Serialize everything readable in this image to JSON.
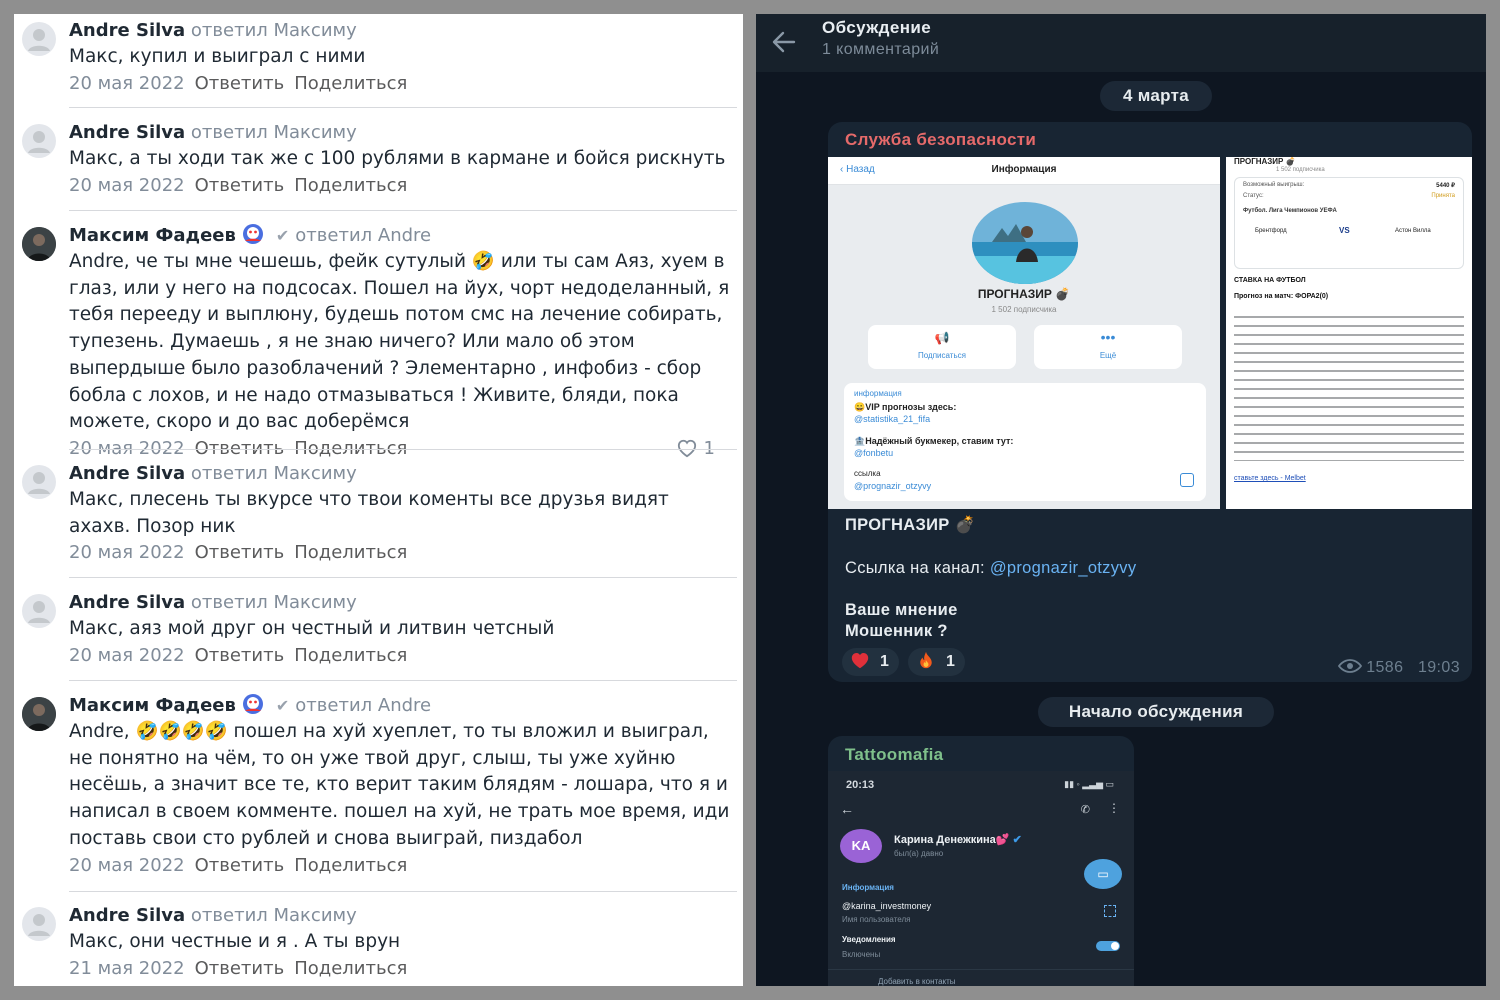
{
  "vk": {
    "comments": [
      {
        "author": "Andre Silva",
        "reply": "ответил Максиму",
        "text": "Макс, купил и выиграл с ними",
        "date": "20 мая 2022",
        "reply_action": "Ответить",
        "share_action": "Поделиться"
      },
      {
        "author": "Andre Silva",
        "reply": "ответил Максиму",
        "text": "Макс, а ты ходи так же с 100 рублями в кармане и бойся рискнуть",
        "date": "20 мая 2022",
        "reply_action": "Ответить",
        "share_action": "Поделиться"
      },
      {
        "author": "Максим Фадеев",
        "reply": "ответил Andre",
        "text": "Andre, че ты мне чешешь, фейк сутулый 🤣 или ты сам Аяз, хуем в глаз, или у него на подсосах. Пошел на йух, чорт недоделанный, я тебя перееду и выплюну, будешь потом смс на лечение собирать, тупезень. Думаешь , я не знаю ничего? Или мало об этом выпердыше было разоблачений ? Элементарно , инфобиз - сбор бобла с лохов, и не надо отмазываться ! Живите, бляди, пока можете, скоро и до вас доберёмся",
        "date": "20 мая 2022",
        "reply_action": "Ответить",
        "share_action": "Поделиться",
        "likes": "1"
      },
      {
        "author": "Andre Silva",
        "reply": "ответил Максиму",
        "text": "Макс, плесень ты вкурсе что твои коменты все друзья видят ахахв. Позор ник",
        "date": "20 мая 2022",
        "reply_action": "Ответить",
        "share_action": "Поделиться"
      },
      {
        "author": "Andre Silva",
        "reply": "ответил Максиму",
        "text": "Макс, аяз мой друг он честный и литвин четсный",
        "date": "20 мая 2022",
        "reply_action": "Ответить",
        "share_action": "Поделиться"
      },
      {
        "author": "Максим Фадеев",
        "reply": "ответил Andre",
        "text": "Andre, 🤣🤣🤣🤣 пошел на хуй хуеплет, то ты вложил и выиграл, не понятно на чём, то он уже твой друг, слыш, ты уже хуйню несёшь, а значит все те, кто верит таким блядям - лошара, что я и написал в своем комменте. пошел на хуй, не трать мое время, иди поставь свои сто рублей и снова выиграй, пиздабол",
        "date": "20 мая 2022",
        "reply_action": "Ответить",
        "share_action": "Поделиться"
      },
      {
        "author": "Andre Silva",
        "reply": "ответил Максиму",
        "text": "Макс, они честные и я . А ты врун",
        "date": "21 мая 2022",
        "reply_action": "Ответить",
        "share_action": "Поделиться"
      }
    ]
  },
  "tg": {
    "header_title": "Обсуждение",
    "header_subtitle": "1 комментарий",
    "date_pill": "4 марта",
    "post": {
      "author": "Служба безопасности",
      "channel_name": "ПРОГНАЗИР 💣",
      "link_label": "Ссылка на канал: ",
      "link": "@prognazir_otzyvy",
      "question1": "Ваше мнение",
      "question2": "Мошенник ?",
      "reaction_heart_count": "1",
      "reaction_fire_count": "1",
      "views": "1586",
      "time": "19:03"
    },
    "screenshot1": {
      "back": "Назад",
      "title": "Информация",
      "name": "ПРОГНАЗИР 💣",
      "subs": "1 502 подписчика",
      "subscribe": "Подписаться",
      "more": "Ещё",
      "info_label": "информация",
      "vip": "😀VIP прогнозы здесь:",
      "vip_link": "@statistika_21_fifa",
      "bookmaker": "🏦Надёжный букмекер, ставим тут:",
      "bookmaker_link": "@fonbetu",
      "link_label": "ссылка",
      "link": "@prognazir_otzyvy"
    },
    "screenshot2": {
      "title": "ПРОГНАЗИР 💣",
      "subs": "1 502 подписчика",
      "win_label": "Возможный выигрыш:",
      "win_value": "5440 ₽",
      "status_label": "Статус:",
      "status_value": "Принята",
      "match": "Футбол. Лига Чемпионов УЕФА",
      "team1": "Брентфорд",
      "vs": "VS",
      "team2": "Астон Вилла",
      "heading": "СТАВКА НА ФУТБОЛ",
      "forecast": "Прогноз на матч: ФОРА2(0)",
      "footer": "ставьте здесь - Melbet"
    },
    "discussion_pill": "Начало обсуждения",
    "comment": {
      "author": "Tattoomafia",
      "phone_time": "20:13",
      "contact_initials": "KA",
      "contact_name": "Карина Денежкина💕",
      "contact_status": "был(а) давно",
      "info_label": "Информация",
      "username": "@karina_investmoney",
      "username_label": "Имя пользователя",
      "notify_label": "Уведомления",
      "notify_state": "Включены",
      "add_contact": "Добавить в контакты"
    }
  },
  "colors": {
    "vk_text": "#1f2933",
    "vk_grey": "#818c99",
    "tg_bg": "#0e1621",
    "tg_bubble": "#182533",
    "tg_author_red": "#e56a6a",
    "tg_author_green": "#7fc08b",
    "tg_link": "#6ab3f3"
  }
}
